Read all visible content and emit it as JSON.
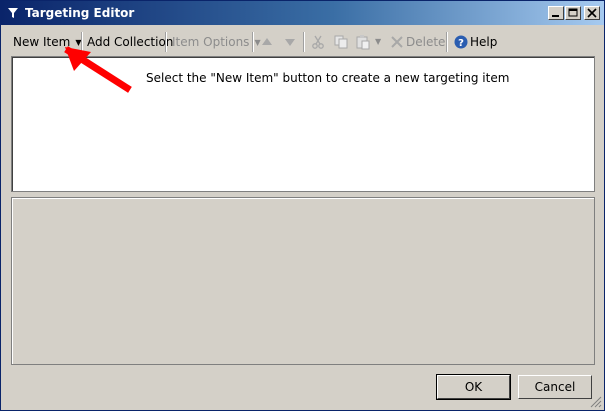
{
  "window": {
    "title": "Targeting Editor"
  },
  "toolbar": {
    "new_item": "New Item",
    "add_collection": "Add Collection",
    "item_options": "Item Options",
    "delete": "Delete",
    "help": "Help",
    "icons": [
      "move-up-icon",
      "move-down-icon",
      "cut-icon",
      "copy-icon",
      "paste-icon",
      "delete-icon",
      "help-icon"
    ]
  },
  "main": {
    "message": "Select the \"New Item\" button to create a new targeting item"
  },
  "buttons": {
    "ok": "OK",
    "cancel": "Cancel"
  },
  "colors": {
    "title_start": "#0a246a",
    "title_end": "#a6caf0",
    "annotation_arrow": "#ff0000",
    "disabled_text": "#8c8c8c",
    "help_icon": "#2a5db0"
  }
}
